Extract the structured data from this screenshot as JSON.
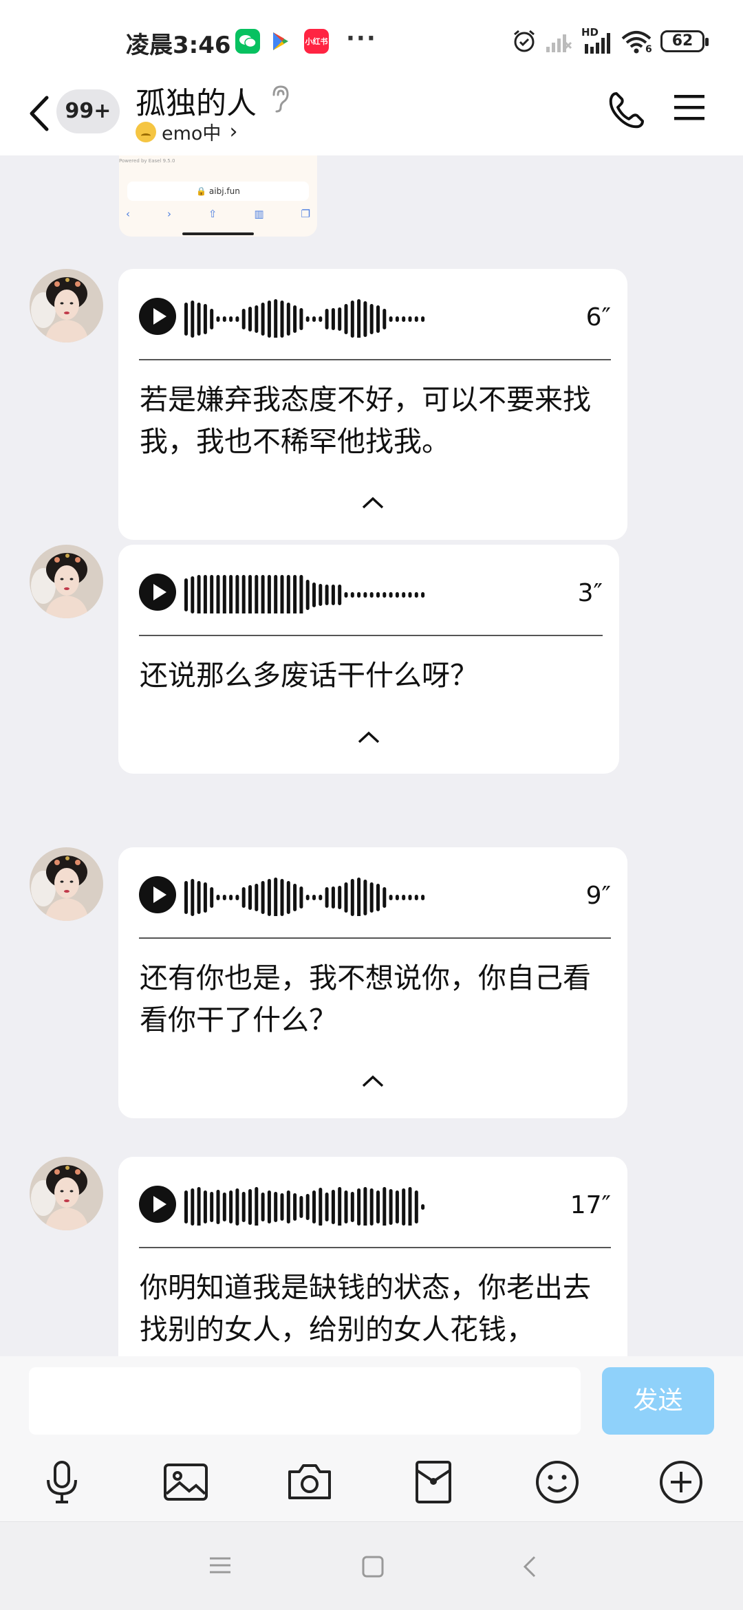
{
  "status": {
    "time": "凌晨3:46",
    "app_icons": [
      {
        "icon": "wechat-icon",
        "color": "#07c160"
      },
      {
        "icon": "play-store-icon",
        "color": "#ffffff"
      },
      {
        "icon": "xiaohongshu-icon",
        "color": "#ff2442",
        "label": "小红书"
      }
    ],
    "more": "···",
    "network_label": "HD",
    "wifi_label": "6",
    "battery": "62"
  },
  "header": {
    "unread_badge": "99+",
    "title": "孤独的人",
    "subtitle": "emo中",
    "subtitle_arrow": "›"
  },
  "chat": {
    "screenshot": {
      "powered_by": "Powered by Easel 9.5.0",
      "url": "🔒 aibj.fun"
    },
    "messages": [
      {
        "duration": "6″",
        "text": "若是嫌弃我态度不好，可以不要来找我，我也不稀罕他找我。"
      },
      {
        "duration": "3″",
        "text": "还说那么多废话干什么呀？"
      },
      {
        "duration": "9″",
        "text": "还有你也是，我不想说你，你自己看看你干了什么？"
      },
      {
        "duration": "17″",
        "text": "你明知道我是缺钱的状态，你老出去找别的女人，给别的女人花钱，"
      }
    ]
  },
  "input": {
    "placeholder": "",
    "send_label": "发送",
    "tools": [
      "mic-icon",
      "image-icon",
      "camera-icon",
      "red-packet-icon",
      "emoji-icon",
      "plus-icon"
    ]
  },
  "colors": {
    "background": "#efeff3",
    "send_button": "#8fd1fa",
    "bubble": "#ffffff"
  }
}
